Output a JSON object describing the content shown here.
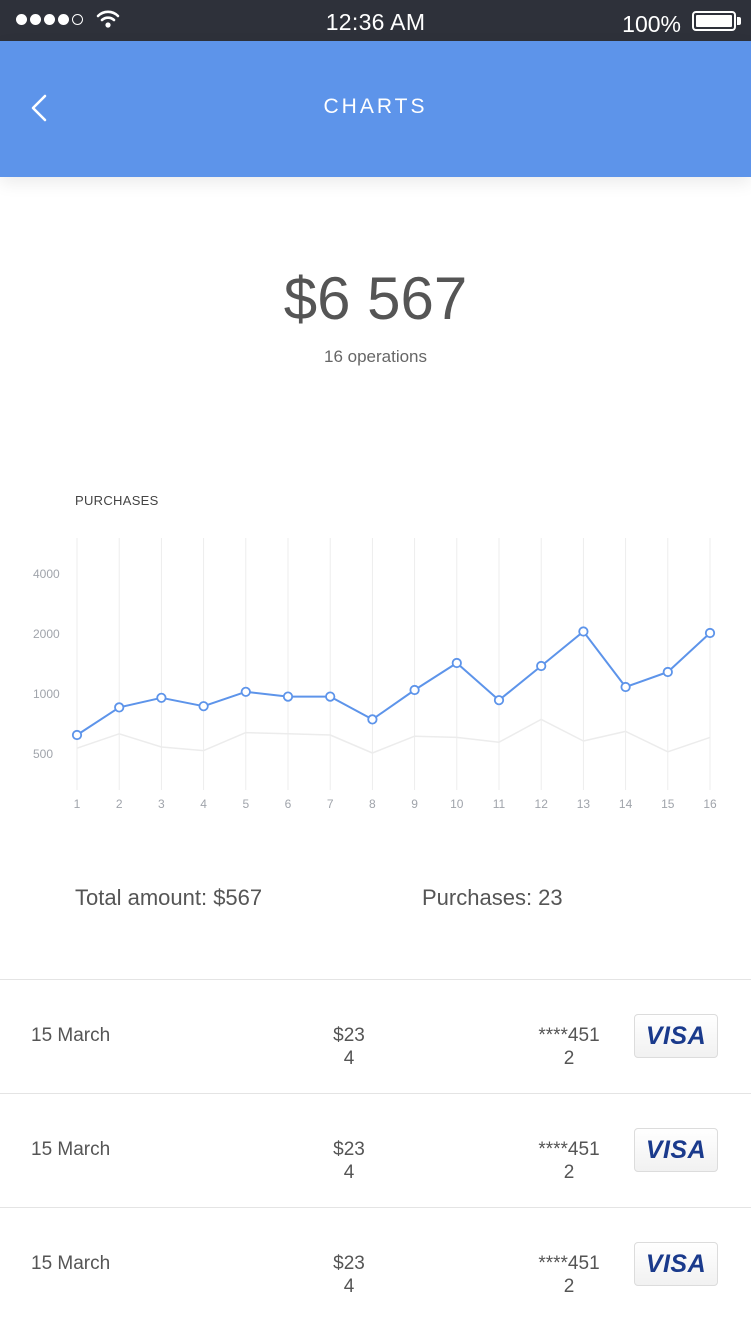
{
  "status": {
    "time": "12:36 AM",
    "battery": "100%"
  },
  "nav": {
    "title": "CHARTS",
    "back_icon": "chevron-left-icon"
  },
  "summary_top": {
    "amount": "$6 567",
    "operations": "16 operations"
  },
  "chart": {
    "title": "PURCHASES"
  },
  "chart_data": {
    "type": "line",
    "title": "PURCHASES",
    "y_ticks": [
      "4000",
      "2000",
      "1000",
      "500"
    ],
    "x": [
      "1",
      "2",
      "3",
      "4",
      "5",
      "6",
      "7",
      "8",
      "9",
      "10",
      "11",
      "12",
      "13",
      "14",
      "15",
      "16"
    ],
    "series": [
      {
        "color": "#5d94ea",
        "values": [
          650,
          880,
          960,
          890,
          1020,
          970,
          970,
          780,
          1050,
          1500,
          940,
          1450,
          2050,
          1100,
          1350,
          2000
        ]
      },
      {
        "color": "#ececec",
        "values": [
          540,
          660,
          550,
          520,
          670,
          660,
          650,
          500,
          640,
          630,
          590,
          780,
          600,
          680,
          510,
          630
        ]
      }
    ]
  },
  "totals": {
    "amount": "Total amount: $567",
    "purchases": "Purchases: 23"
  },
  "transactions": [
    {
      "date": "15 March",
      "price_1": "$23",
      "price_2": "4",
      "card_1": "****451",
      "card_2": "2",
      "brand": "VISA"
    },
    {
      "date": "15 March",
      "price_1": "$23",
      "price_2": "4",
      "card_1": "****451",
      "card_2": "2",
      "brand": "VISA"
    },
    {
      "date": "15 March",
      "price_1": "$23",
      "price_2": "4",
      "card_1": "****451",
      "card_2": "2",
      "brand": "VISA"
    }
  ]
}
